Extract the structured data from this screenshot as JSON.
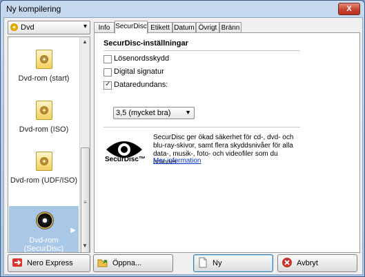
{
  "window": {
    "title": "Ny kompilering",
    "close_glyph": "X"
  },
  "disc_type": {
    "selected": "Dvd",
    "icon": "disc-icon"
  },
  "formats": [
    {
      "label": "Dvd-rom (start)"
    },
    {
      "label": "Dvd-rom (ISO)"
    },
    {
      "label": "Dvd-rom (UDF/ISO)"
    },
    {
      "label": "Dvd-rom (SecurDisc)",
      "selected": true
    }
  ],
  "tabs": [
    {
      "label": "Info"
    },
    {
      "label": "SecurDisc",
      "active": true
    },
    {
      "label": "Etikett"
    },
    {
      "label": "Datum"
    },
    {
      "label": "Övrigt"
    },
    {
      "label": "Bränn"
    }
  ],
  "securdisc": {
    "section_title": "SecurDisc-inställningar",
    "options": [
      {
        "label": "Lösenordsskydd",
        "checked": false
      },
      {
        "label": "Digital signatur",
        "checked": false
      },
      {
        "label": "Dataredundans:",
        "checked": true
      }
    ],
    "redundancy_value": "3,5 (mycket bra)",
    "logo_text": "SecurDisc™",
    "description": "SecurDisc ger ökad säkerhet för cd-, dvd- och blu-ray-skivor, samt flera skyddsnivåer för alla data-, musik-, foto- och videofiler som du bränner.",
    "more_link": "Mer information"
  },
  "buttons": {
    "nero_express": "Nero Express",
    "open": "Öppna...",
    "new": "Ny",
    "cancel": "Avbryt"
  },
  "colors": {
    "selection": "#a9c8e8",
    "link": "#0033cc",
    "cancel_icon": "#c8302a"
  }
}
